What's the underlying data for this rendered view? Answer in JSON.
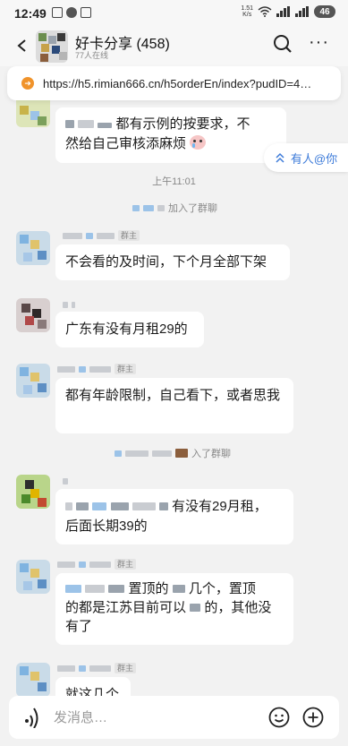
{
  "status_bar": {
    "time": "12:49",
    "net_speed": "1.51",
    "net_unit": "K/s",
    "battery": "46"
  },
  "header": {
    "title": "好卡分享 (458)",
    "subtitle": "77人在线",
    "icons": [
      "back-arrow-icon",
      "search-icon",
      "more-icon"
    ]
  },
  "url_bar": {
    "url": "https://h5.rimian666.cn/h5orderEn/index?pudID=4…"
  },
  "mention_pill": {
    "label": "有人@你"
  },
  "chat": {
    "timestamp": "上午11:01",
    "system_joined_1": "加入了群聊",
    "system_joined_2": "入了群聊",
    "role_tag": "群主",
    "messages": [
      {
        "text_line1_tail": "都有示例的按要求，不",
        "text_line2": "然给自己审核添麻烦"
      },
      {
        "text": "不会看的及时间，下个月全部下架"
      },
      {
        "text": "广东有没有月租29的"
      },
      {
        "text": "都有年龄限制，自己看下，或者思我"
      },
      {
        "text_line1_tail": "有没有29月租，",
        "text_line2": "后面长期39的"
      },
      {
        "text_line1_mid": "置顶的",
        "text_line1_tail": "几个，置顶",
        "text_line2_head": "的都是江苏目前可以",
        "text_line2_tail": "的，其他没",
        "text_line3": "有了"
      },
      {
        "text": "就这几个"
      }
    ]
  },
  "input_bar": {
    "placeholder": "发消息…"
  },
  "colors": {
    "background": "#f2f2f2",
    "bubble": "#ffffff",
    "link_blue": "#3d7bd9",
    "url_icon": "#f0932b"
  }
}
